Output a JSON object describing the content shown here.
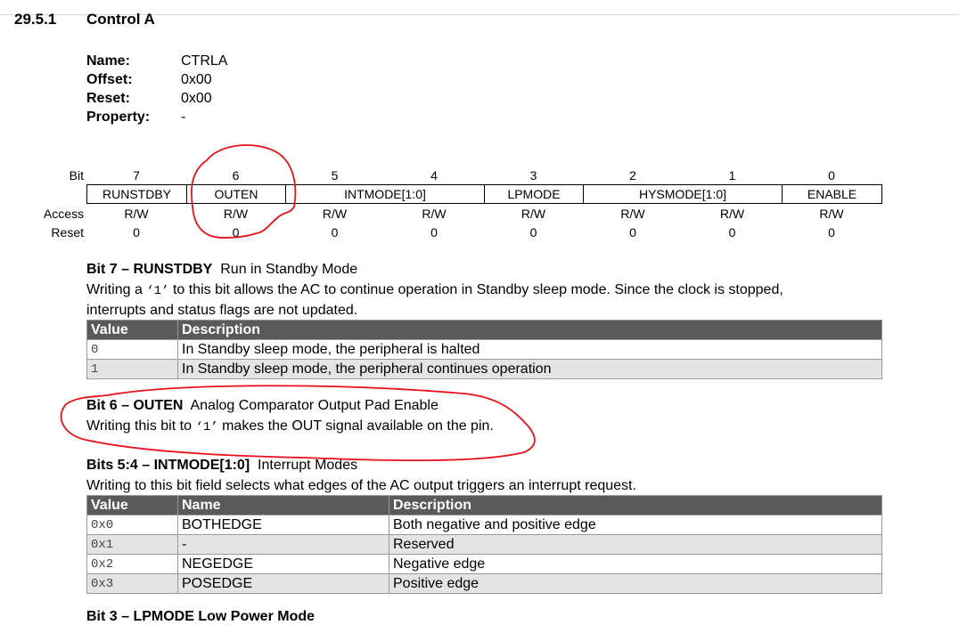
{
  "section": {
    "number": "29.5.1",
    "title": "Control A"
  },
  "properties": [
    {
      "key": "Name:",
      "value": "CTRLA"
    },
    {
      "key": "Offset:",
      "value": "0x00"
    },
    {
      "key": "Reset:",
      "value": "0x00"
    },
    {
      "key": "Property:",
      "value": "-"
    }
  ],
  "register": {
    "bit_label": "Bit",
    "access_label": "Access",
    "reset_label": "Reset",
    "bits": [
      "7",
      "6",
      "5",
      "4",
      "3",
      "2",
      "1",
      "0"
    ],
    "fields": [
      "RUNSTDBY",
      "OUTEN",
      "INTMODE[1:0]",
      "LPMODE",
      "HYSMODE[1:0]",
      "ENABLE"
    ],
    "access": [
      "R/W",
      "R/W",
      "R/W",
      "R/W",
      "R/W",
      "R/W",
      "R/W",
      "R/W"
    ],
    "reset": [
      "0",
      "0",
      "0",
      "0",
      "0",
      "0",
      "0",
      "0"
    ]
  },
  "bit7": {
    "heading_bold": "Bit 7 – RUNSTDBY",
    "heading_rest": "Run in Standby Mode",
    "para_before": "Writing a ",
    "para_code": "‘1’",
    "para_after": " to this bit allows the AC to continue operation in Standby sleep mode. Since the clock is stopped,",
    "para_line2": "interrupts and status flags are not updated.",
    "headers": [
      "Value",
      "Description"
    ],
    "rows": [
      {
        "value": "0",
        "desc": "In Standby sleep mode, the peripheral is halted"
      },
      {
        "value": "1",
        "desc": "In Standby sleep mode, the peripheral continues operation"
      }
    ]
  },
  "bit6": {
    "heading_bold": "Bit 6 – OUTEN",
    "heading_rest": "Analog Comparator Output Pad Enable",
    "para_before": "Writing this bit to ",
    "para_code": "‘1’",
    "para_after": " makes the OUT signal available on the pin."
  },
  "bits54": {
    "heading_bold": "Bits 5:4 – INTMODE[1:0]",
    "heading_rest": "Interrupt Modes",
    "para": "Writing to this bit field selects what edges of the AC output triggers an interrupt request.",
    "headers": [
      "Value",
      "Name",
      "Description"
    ],
    "rows": [
      {
        "value": "0x0",
        "name": "BOTHEDGE",
        "desc": "Both negative and positive edge"
      },
      {
        "value": "0x1",
        "name": "-",
        "desc": "Reserved"
      },
      {
        "value": "0x2",
        "name": "NEGEDGE",
        "desc": "Negative edge"
      },
      {
        "value": "0x3",
        "name": "POSEDGE",
        "desc": "Positive edge"
      }
    ]
  },
  "next_heading": "Bit 3 – LPMODE Low Power Mode",
  "annotation_color": "#e8101a"
}
